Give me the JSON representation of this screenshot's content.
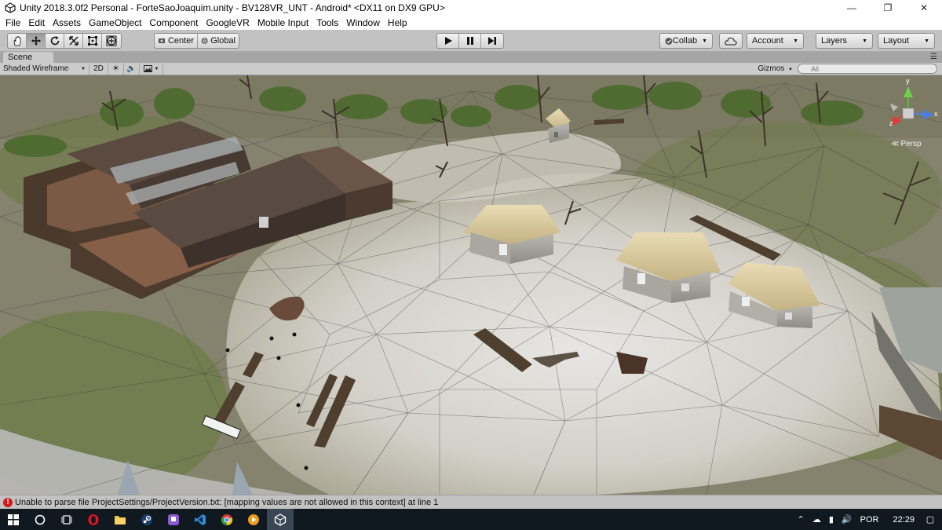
{
  "window": {
    "title": "Unity 2018.3.0f2 Personal - ForteSaoJoaquim.unity - BV128VR_UNT - Android* <DX11 on DX9 GPU>",
    "minimize_icon": "minimize-icon",
    "maximize_icon": "restore-icon",
    "close_icon": "close-icon"
  },
  "menubar": {
    "items": [
      "File",
      "Edit",
      "Assets",
      "GameObject",
      "Component",
      "GoogleVR",
      "Mobile Input",
      "Tools",
      "Window",
      "Help"
    ]
  },
  "toolbar": {
    "transform_tools": [
      "hand-tool-icon",
      "move-tool-icon",
      "rotate-tool-icon",
      "scale-tool-icon",
      "rect-tool-icon",
      "transform-tool-icon"
    ],
    "pivot_label": "Center",
    "space_label": "Global",
    "collab_label": "Collab",
    "account_label": "Account",
    "layers_label": "Layers",
    "layout_label": "Layout"
  },
  "scene_panel": {
    "tab_label": "Scene",
    "shading_mode": "Shaded Wireframe",
    "mode_2d": "2D",
    "gizmos_label": "Gizmos",
    "search_placeholder": "All",
    "projection_label": "Persp",
    "gizmo_y": "y",
    "gizmo_x": "x",
    "gizmo_z": "z"
  },
  "statusbar": {
    "message": "Unable to parse file ProjectSettings/ProjectVersion.txt: [mapping values are not allowed in this context] at line 1"
  },
  "taskbar": {
    "language": "POR",
    "time": "22:29"
  },
  "colors": {
    "error": "#d21919",
    "taskbar": "#101820",
    "editor_gray": "#c2c2c2"
  }
}
